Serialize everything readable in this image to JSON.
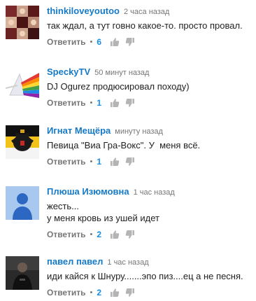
{
  "comments": [
    {
      "author": "thinkiloveyoutoo",
      "time": "2 часа назад",
      "text": "так ждал, а тут говно какое-то. просто провал.",
      "reply_label": "Ответить",
      "likes": "6",
      "avatar": "photo-grid-avatar"
    },
    {
      "author": "SpeckyTV",
      "time": "50 минут назад",
      "text": "DJ Ogurez продюсировал походу)",
      "reply_label": "Ответить",
      "likes": "1",
      "avatar": "rainbow-prism-avatar"
    },
    {
      "author": "Игнат Мещёра",
      "time": "минуту назад",
      "text": "Певица \"Виа Гра-Вокс\". У  меня всё.",
      "reply_label": "Ответить",
      "likes": "1",
      "avatar": "eagle-flag-avatar"
    },
    {
      "author": "Плюша Изюмовна",
      "time": "1 час назад",
      "text": "жесть...\nу меня кровь из ушей идет",
      "reply_label": "Ответить",
      "likes": "2",
      "avatar": "default-user-avatar"
    },
    {
      "author": "павел павел",
      "time": "1 час назад",
      "text": "иди кайся к Шнуру.......эпо пиз....ец а не песня.",
      "reply_label": "Ответить",
      "likes": "2",
      "avatar": "dark-photo-avatar"
    }
  ],
  "colors": {
    "author": "#167ac6",
    "likes": "#128ee9",
    "muted": "#767676",
    "thumb": "#b4b4b4"
  }
}
